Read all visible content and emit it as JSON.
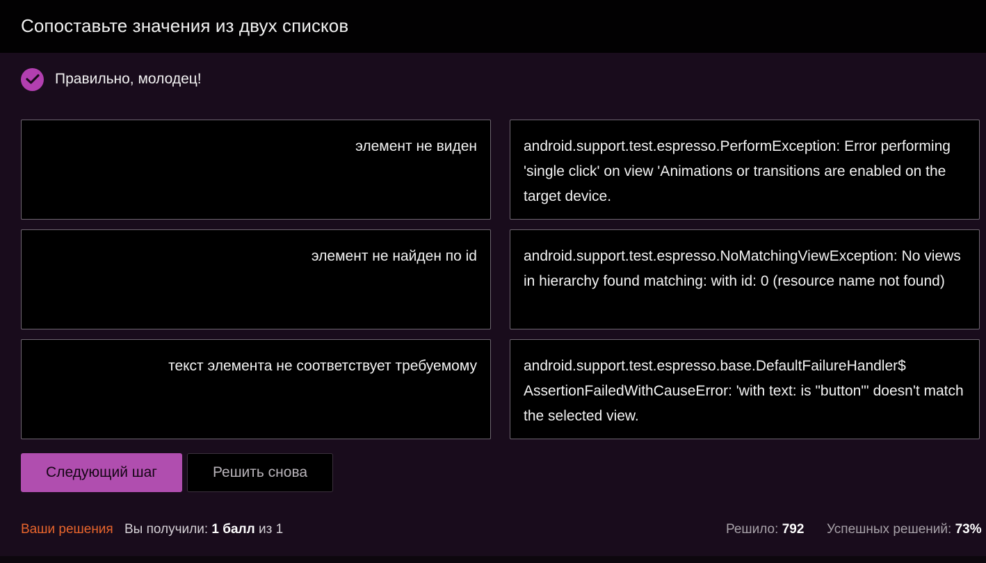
{
  "header": {
    "title": "Сопоставьте значения из двух списков"
  },
  "status": {
    "text": "Правильно, молодец!",
    "icon": "check-circle-icon",
    "accent": "#b23fb0"
  },
  "pairs": [
    {
      "left": "элемент не виден",
      "right": "android.support.test.espresso.PerformException: Error performing 'single click' on view 'Animations or transitions are enabled on the target device."
    },
    {
      "left": "элемент не найден по id",
      "right": "android.support.test.espresso.NoMatchingViewException: No views in hierarchy found matching: with id: 0 (resource name not found)"
    },
    {
      "left": "текст элемента не соответствует требуемому",
      "right": "android.support.test.espresso.base.DefaultFailureHandler$ AssertionFailedWithCauseError: 'with text: is \"button\"' doesn't match the selected view."
    }
  ],
  "buttons": {
    "next": "Следующий шаг",
    "retry": "Решить снова"
  },
  "footer": {
    "solutions_link": "Ваши решения",
    "score_label": "Вы получили:",
    "score_value": "1 балл",
    "score_of": "из 1",
    "solved_label": "Решило:",
    "solved_value": "792",
    "success_label": "Успешных решений:",
    "success_value": "73%"
  },
  "colors": {
    "background": "#190c1c",
    "header": "#020102",
    "primary_button": "#b04eaf",
    "link": "#e8652c"
  }
}
